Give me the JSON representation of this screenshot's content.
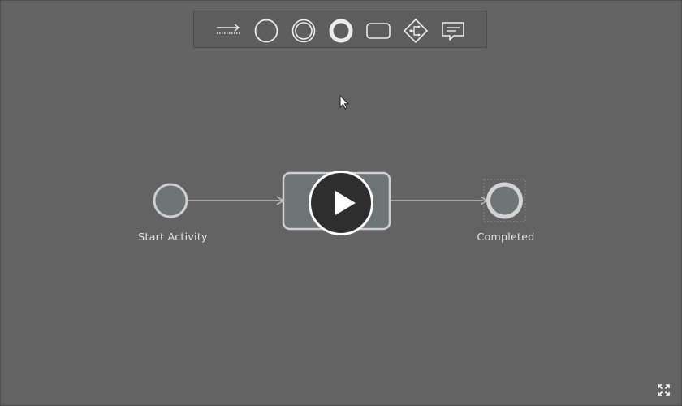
{
  "canvas": {
    "background_color": "#636363"
  },
  "palette": {
    "tools": [
      {
        "name": "sequence-flow-tool",
        "icon": "connector-arrow-icon"
      },
      {
        "name": "start-event-tool",
        "icon": "circle-icon"
      },
      {
        "name": "intermediate-event-tool",
        "icon": "double-circle-icon"
      },
      {
        "name": "end-event-tool",
        "icon": "thick-circle-icon"
      },
      {
        "name": "task-tool",
        "icon": "rounded-rectangle-icon"
      },
      {
        "name": "gateway-tool",
        "icon": "diamond-branch-icon"
      },
      {
        "name": "annotation-tool",
        "icon": "speech-bubble-icon"
      }
    ]
  },
  "diagram": {
    "start_event": {
      "label": "Start Activity"
    },
    "task": {
      "label": ""
    },
    "end_event": {
      "label": "Completed"
    }
  },
  "video_overlay": {
    "icon": "play-icon"
  },
  "controls": {
    "fullscreen_icon": "expand-icon"
  },
  "colors": {
    "node_fill": "#6e7575",
    "node_stroke": "#cfcfcf",
    "edge": "#bfbfbf",
    "label_text": "#e6e6e6"
  }
}
